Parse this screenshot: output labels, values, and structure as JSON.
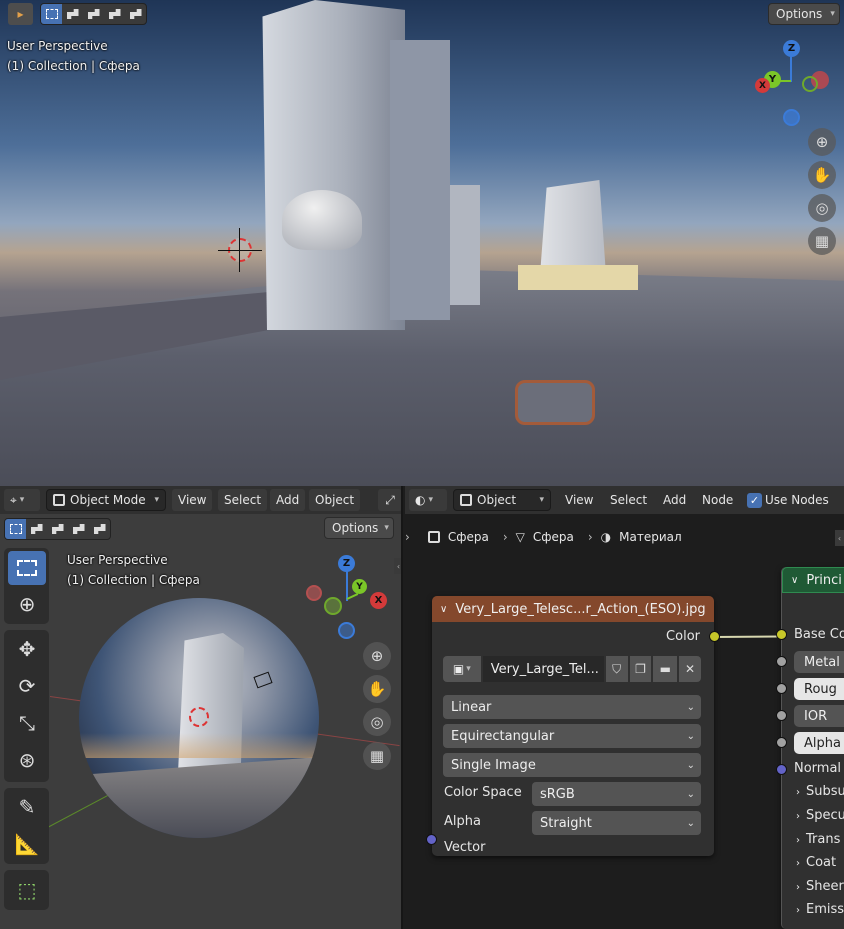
{
  "top_viewport": {
    "perspective_label": "User Perspective",
    "collection_label": "(1) Collection | Сфера",
    "options_label": "Options",
    "gizmo": {
      "z": "Z",
      "y": "Y",
      "x": "X"
    }
  },
  "viewport3d": {
    "editor_icon": "view3d-icon",
    "mode_label": "Object Mode",
    "menu": [
      "View",
      "Select",
      "Add",
      "Object"
    ],
    "options_label": "Options",
    "perspective_label": "User Perspective",
    "collection_label": "(1) Collection | Сфера",
    "gizmo": {
      "z": "Z",
      "y": "Y",
      "x": "X"
    },
    "tools": [
      "select-box-icon",
      "cursor-icon",
      "move-icon",
      "rotate-icon",
      "scale-icon",
      "transform-icon",
      "annotate-icon",
      "measure-icon",
      "add-cube-icon"
    ]
  },
  "node_editor": {
    "shader_type": "Object",
    "menu": [
      "View",
      "Select",
      "Add",
      "Node"
    ],
    "use_nodes_label": "Use Nodes",
    "use_nodes_checked": true,
    "breadcrumb": [
      "Сфера",
      "Сфера",
      "Материал"
    ],
    "image_node": {
      "title": "Very_Large_Telesc...r_Action_(ESO).jpg",
      "output_label": "Color",
      "image_name": "Very_Large_Tel...",
      "interpolation": "Linear",
      "projection": "Equirectangular",
      "source": "Single Image",
      "color_space_label": "Color Space",
      "color_space_value": "sRGB",
      "alpha_label": "Alpha",
      "alpha_value": "Straight",
      "input_label": "Vector"
    },
    "principled_node": {
      "title": "Princi",
      "inputs": [
        "Base Co",
        "Metal",
        "Roug",
        "IOR",
        "Alpha",
        "Normal"
      ],
      "panels": [
        "Subsu",
        "Specu",
        "Trans",
        "Coat",
        "Sheer",
        "Emiss"
      ]
    },
    "colors": {
      "accent": "#4772b3",
      "image_header": "#84482c",
      "shader_header": "#1f5a35",
      "color_socket": "#c7c729",
      "vector_socket": "#6363c7"
    }
  }
}
